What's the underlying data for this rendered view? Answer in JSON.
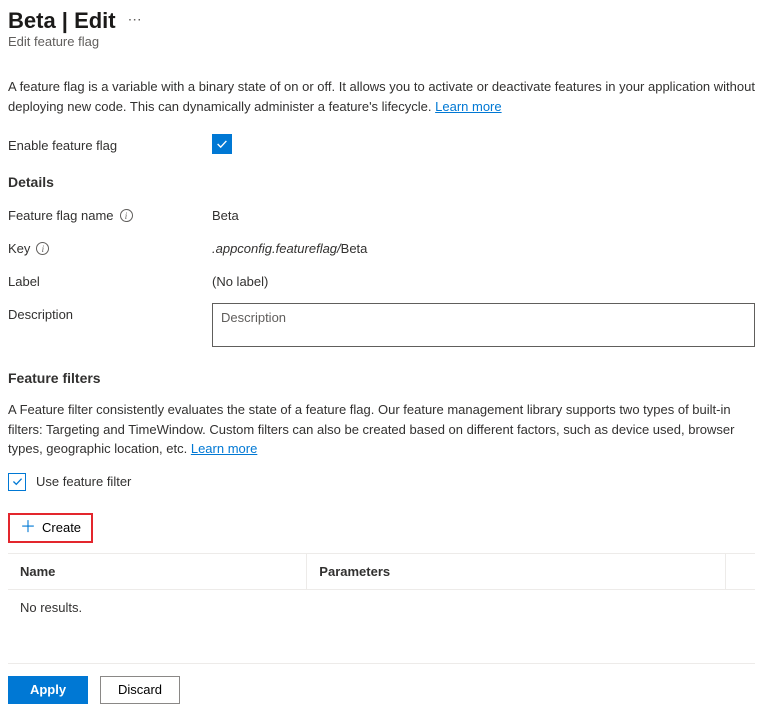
{
  "header": {
    "title": "Beta | Edit",
    "subtitle": "Edit feature flag"
  },
  "intro": {
    "text": "A feature flag is a variable with a binary state of on or off. It allows you to activate or deactivate features in your application without deploying new code. This can dynamically administer a feature's lifecycle. ",
    "learn_more": "Learn more"
  },
  "enable_row": {
    "label": "Enable feature flag",
    "checked": true
  },
  "details": {
    "heading": "Details",
    "name_label": "Feature flag name",
    "name_value": "Beta",
    "key_label": "Key",
    "key_prefix": ".appconfig.featureflag/",
    "key_value": "Beta",
    "label_label": "Label",
    "label_value": "(No label)",
    "description_label": "Description",
    "description_placeholder": "Description",
    "description_value": ""
  },
  "filters": {
    "heading": "Feature filters",
    "text": "A Feature filter consistently evaluates the state of a feature flag. Our feature management library supports two types of built-in filters: Targeting and TimeWindow. Custom filters can also be created based on different factors, such as device used, browser types, geographic location, etc. ",
    "learn_more": "Learn more",
    "use_filter_label": "Use feature filter",
    "use_filter_checked": true,
    "create_label": "Create",
    "table": {
      "col_name": "Name",
      "col_params": "Parameters",
      "no_results": "No results."
    }
  },
  "footer": {
    "apply": "Apply",
    "discard": "Discard"
  }
}
